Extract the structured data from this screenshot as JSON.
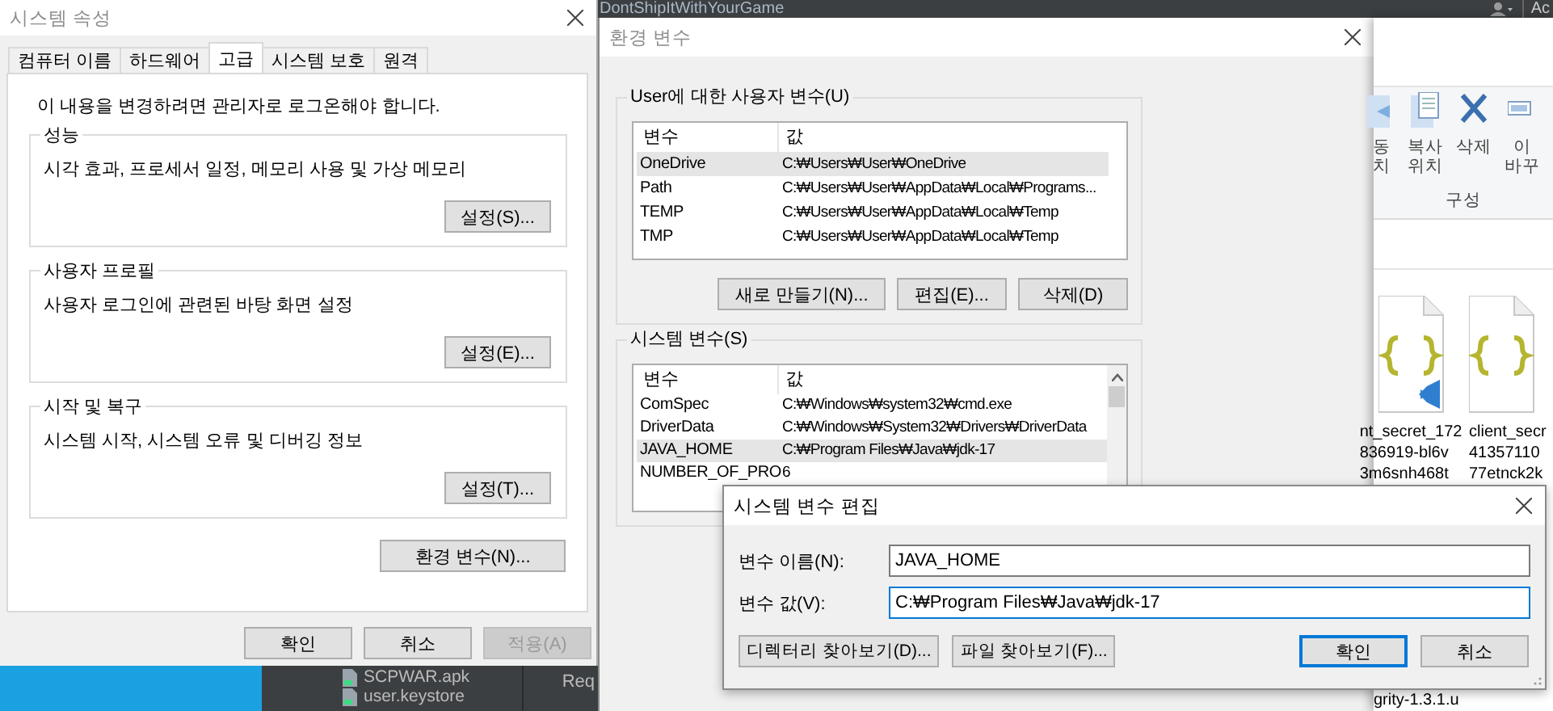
{
  "top_bar": {
    "title": "DontShipItWithYourGame",
    "right_text": "Ac"
  },
  "system_properties": {
    "title": "시스템 속성",
    "tabs": [
      {
        "label": "컴퓨터 이름",
        "selected": false
      },
      {
        "label": "하드웨어",
        "selected": false
      },
      {
        "label": "고급",
        "selected": true
      },
      {
        "label": "시스템 보호",
        "selected": false
      },
      {
        "label": "원격",
        "selected": false
      }
    ],
    "notice": "이 내용을 변경하려면 관리자로 로그온해야 합니다.",
    "groups": [
      {
        "title": "성능",
        "description": "시각 효과, 프로세서 일정, 메모리 사용 및 가상 메모리",
        "button": "설정(S)..."
      },
      {
        "title": "사용자 프로필",
        "description": "사용자 로그인에 관련된 바탕 화면 설정",
        "button": "설정(E)..."
      },
      {
        "title": "시작 및 복구",
        "description": "시스템 시작, 시스템 오류 및 디버깅 정보",
        "button": "설정(T)..."
      }
    ],
    "env_button": "환경 변수(N)...",
    "buttons": [
      {
        "label": "확인",
        "disabled": false
      },
      {
        "label": "취소",
        "disabled": false
      },
      {
        "label": "적용(A)",
        "disabled": true
      }
    ]
  },
  "ide": {
    "files": [
      "SCPWAR.apk",
      "user.keystore"
    ],
    "column_text": "Req"
  },
  "environment_variables": {
    "title": "환경 변수",
    "user_group": {
      "title": "User에 대한 사용자 변수(U)",
      "columns": [
        "변수",
        "값"
      ],
      "rows": [
        {
          "name": "OneDrive",
          "value": "C:₩Users₩User₩OneDrive",
          "selected": true
        },
        {
          "name": "Path",
          "value": "C:₩Users₩User₩AppData₩Local₩Programs...",
          "selected": false
        },
        {
          "name": "TEMP",
          "value": "C:₩Users₩User₩AppData₩Local₩Temp",
          "selected": false
        },
        {
          "name": "TMP",
          "value": "C:₩Users₩User₩AppData₩Local₩Temp",
          "selected": false
        }
      ],
      "buttons": [
        "새로 만들기(N)...",
        "편집(E)...",
        "삭제(D)"
      ]
    },
    "system_group": {
      "title": "시스템 변수(S)",
      "columns": [
        "변수",
        "값"
      ],
      "rows": [
        {
          "name": "ComSpec",
          "value": "C:₩Windows₩system32₩cmd.exe",
          "selected": false
        },
        {
          "name": "DriverData",
          "value": "C:₩Windows₩System32₩Drivers₩DriverData",
          "selected": false
        },
        {
          "name": "JAVA_HOME",
          "value": "C:₩Program Files₩Java₩jdk-17",
          "selected": true
        },
        {
          "name": "NUMBER_OF_PRO",
          "value": "6",
          "selected": false
        }
      ]
    }
  },
  "explorer": {
    "ribbon_items": [
      {
        "kind": "move",
        "lines": [
          "동",
          "치"
        ]
      },
      {
        "kind": "copy",
        "lines": [
          "복사",
          "위치"
        ]
      },
      {
        "kind": "delete",
        "lines": [
          "삭제"
        ]
      },
      {
        "kind": "rename",
        "lines": [
          "이",
          "바꾸"
        ]
      }
    ],
    "group_label": "구성",
    "files": [
      {
        "lines": [
          "nt_secret_172",
          "836919-bl6v",
          "3m6snh468t"
        ]
      },
      {
        "lines": [
          "client_secr",
          "41357110",
          "77etnck2k"
        ]
      }
    ],
    "lower_file_lines": [
      "grity-1.3.1.u"
    ]
  },
  "edit_dialog": {
    "title": "시스템 변수 편집",
    "fields": [
      {
        "label": "변수 이름(N):",
        "value": "JAVA_HOME",
        "focused": false
      },
      {
        "label": "변수 값(V):",
        "value": "C:₩Program Files₩Java₩jdk-17",
        "focused": true
      }
    ],
    "browse_buttons": [
      "디렉터리 찾아보기(D)...",
      "파일 찾아보기(F)..."
    ],
    "buttons": [
      {
        "label": "확인",
        "default": true
      },
      {
        "label": "취소",
        "default": false
      }
    ]
  }
}
